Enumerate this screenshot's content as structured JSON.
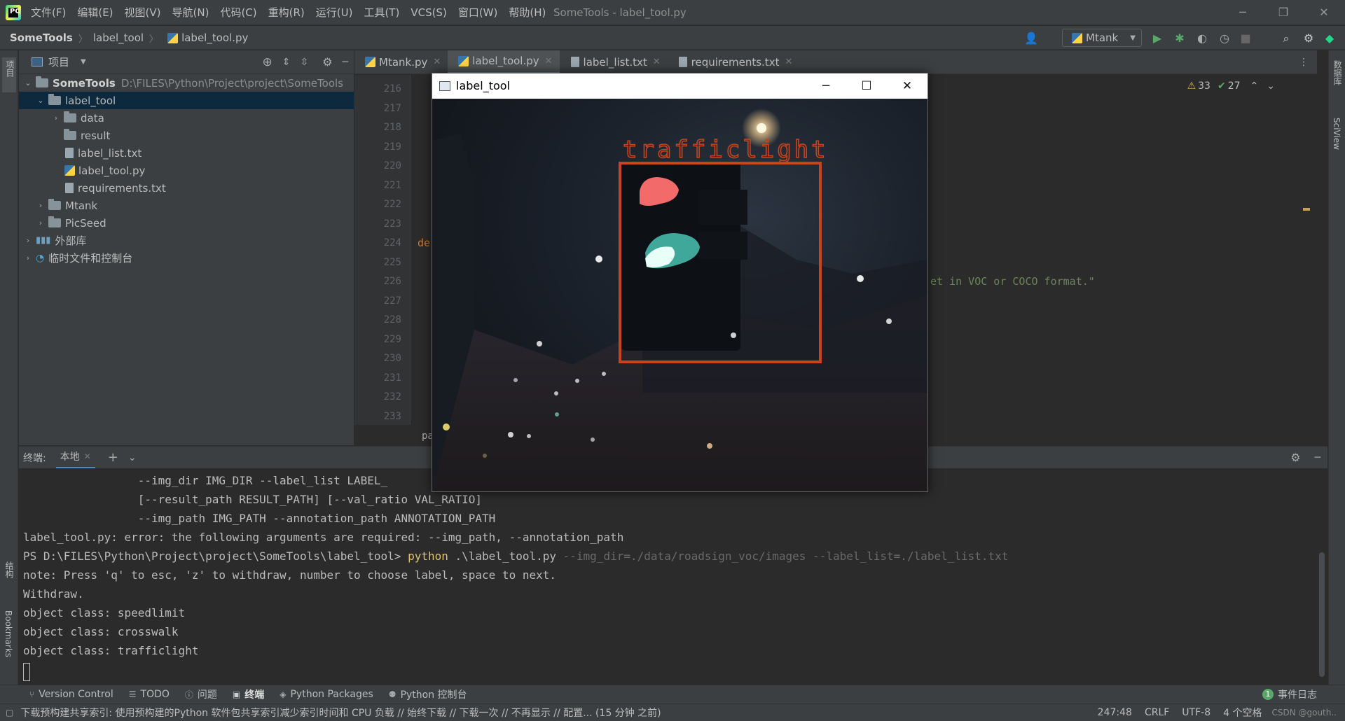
{
  "app": {
    "menu": [
      "文件(F)",
      "编辑(E)",
      "视图(V)",
      "导航(N)",
      "代码(C)",
      "重构(R)",
      "运行(U)",
      "工具(T)",
      "VCS(S)",
      "窗口(W)",
      "帮助(H)"
    ],
    "window_title": "SomeTools - label_tool.py",
    "logo_text": "PC"
  },
  "breadcrumb": [
    "SomeTools",
    "label_tool",
    "label_tool.py"
  ],
  "run_config": "Mtank",
  "left_strip": {
    "project": "项目",
    "structure": "结构",
    "bookmarks": "Bookmarks"
  },
  "right_strip": {
    "database": "数据库",
    "sciview": "SciView"
  },
  "project_panel": {
    "title": "项目",
    "tree": [
      {
        "label": "SomeTools",
        "path": "D:\\FILES\\Python\\Project\\project\\SomeTools"
      },
      {
        "label": "label_tool"
      },
      {
        "label": "data"
      },
      {
        "label": "result"
      },
      {
        "label": "label_list.txt"
      },
      {
        "label": "label_tool.py"
      },
      {
        "label": "requirements.txt"
      },
      {
        "label": "Mtank"
      },
      {
        "label": "PicSeed"
      },
      {
        "label": "外部库"
      },
      {
        "label": "临时文件和控制台"
      }
    ]
  },
  "editor": {
    "tabs": [
      {
        "label": "Mtank.py"
      },
      {
        "label": "label_tool.py"
      },
      {
        "label": "label_list.txt"
      },
      {
        "label": "requirements.txt"
      }
    ],
    "line_numbers": [
      "216",
      "217",
      "218",
      "219",
      "220",
      "221",
      "222",
      "223",
      "224",
      "225",
      "226",
      "227",
      "228",
      "229",
      "230",
      "231",
      "232",
      "233"
    ],
    "visible_code": {
      "line224": "de",
      "line226": "et in VOC or COCO format.\""
    },
    "breadcrumb_fragment": "pa",
    "warnings": "33",
    "ok_count": "27"
  },
  "image_window": {
    "title": "label_tool",
    "bbox_label": "trafficlight",
    "bbox_color": "#c8441c"
  },
  "terminal": {
    "label": "终端:",
    "tab": "本地",
    "lines": [
      "                 --img_dir IMG_DIR --label_list LABEL_",
      "                 [--result_path RESULT_PATH] [--val_ratio VAL_RATIO]",
      "                 --img_path IMG_PATH --annotation_path ANNOTATION_PATH",
      "label_tool.py: error: the following arguments are required: --img_path, --annotation_path"
    ],
    "prompt": "PS D:\\FILES\\Python\\Project\\project\\SomeTools\\label_tool> ",
    "cmd_kw": "python",
    "cmd_main": " .\\label_tool.py ",
    "cmd_args": "--img_dir=./data/roadsign_voc/images --label_list=./label_list.txt",
    "output": [
      "note: Press 'q' to esc, 'z' to withdraw, number to choose label, space to next.",
      "Withdraw.",
      "object class: speedlimit",
      "object class: crosswalk",
      "object class: trafficlight"
    ]
  },
  "bottom_tools": [
    "Version Control",
    "TODO",
    "问题",
    "终端",
    "Python Packages",
    "Python 控制台"
  ],
  "event_log": "事件日志",
  "event_count": "1",
  "status": {
    "message": "下载预构建共享索引: 使用预构建的Python 软件包共享索引减少索引时间和 CPU 负载 // 始终下载 // 下载一次 // 不再显示 // 配置... (15 分钟 之前)",
    "position": "247:48",
    "line_sep": "CRLF",
    "encoding": "UTF-8",
    "indent": "4 个空格",
    "watermark": "CSDN @gouth.."
  },
  "colors": {
    "accent": "#4a88c7",
    "selection": "#0d293e",
    "run_green": "#59a869"
  }
}
